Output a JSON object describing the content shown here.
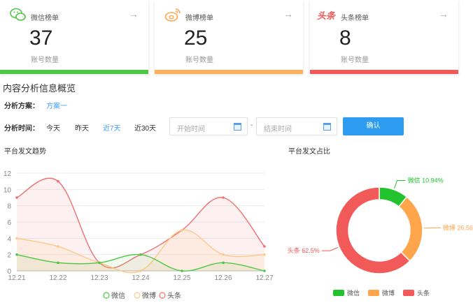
{
  "cards": [
    {
      "title": "微信榜单",
      "value": "37",
      "sub": "账号数量",
      "color": "#4cc844",
      "logo": "wechat-icon"
    },
    {
      "title": "微博榜单",
      "value": "25",
      "sub": "账号数量",
      "color": "#ffb05c",
      "logo": "weibo-icon"
    },
    {
      "title": "头条榜单",
      "value": "8",
      "sub": "账号数量",
      "color": "#f25a5a",
      "logo": "toutiao-icon",
      "logo_text": "头条"
    }
  ],
  "arrow": "→",
  "section_title": "内容分析信息概览",
  "plan": {
    "label": "分析方案：",
    "value": "方案一"
  },
  "time": {
    "label": "分析时间：",
    "options": [
      "今天",
      "昨天",
      "近7天",
      "近30天"
    ],
    "active": 2,
    "start_placeholder": "开始时间",
    "end_placeholder": "结束时间",
    "separator": "-",
    "confirm": "确认"
  },
  "colors": {
    "wechat": "#4cc844",
    "weibo": "#ffc888",
    "toutiao": "#f07070",
    "accent": "#409eff"
  },
  "chart_data": [
    {
      "type": "area",
      "title": "平台发文趋势",
      "categories": [
        "12.21",
        "12.22",
        "12.23",
        "12.24",
        "12.25",
        "12.26",
        "12.27"
      ],
      "ylim": [
        0,
        12
      ],
      "yticks": [
        0,
        2,
        4,
        6,
        8,
        10,
        12
      ],
      "grid": true,
      "legend": "bottom",
      "series": [
        {
          "name": "微信",
          "values": [
            2,
            1,
            1,
            2,
            0,
            1,
            0
          ]
        },
        {
          "name": "微博",
          "values": [
            4,
            3,
            1,
            0,
            5,
            2,
            2
          ]
        },
        {
          "name": "头条",
          "values": [
            9,
            11,
            1,
            2,
            5,
            9,
            3
          ]
        }
      ]
    },
    {
      "type": "pie",
      "title": "平台发文占比",
      "legend": "bottom",
      "slices": [
        {
          "name": "微信",
          "value": 10.94,
          "label": "微信 10.94%",
          "color": "#22c32e"
        },
        {
          "name": "微博",
          "value": 26.56,
          "label": "微博 26.56%",
          "color": "#ffa64d"
        },
        {
          "name": "头条",
          "value": 62.5,
          "label": "头条 62.5%",
          "color": "#f25a5a"
        }
      ]
    }
  ]
}
